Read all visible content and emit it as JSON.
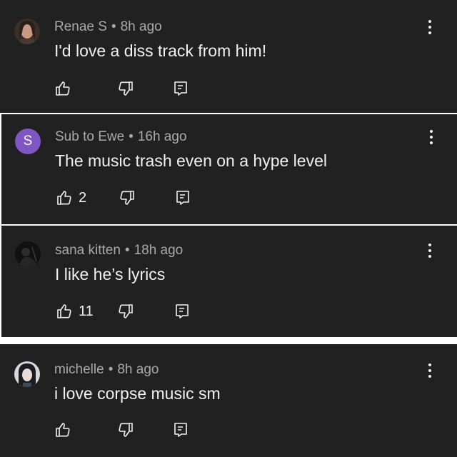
{
  "comments": [
    {
      "author": "Renae S",
      "time": "8h ago",
      "text": "I'd love a diss track from him!",
      "likes": "",
      "avatar_type": "photo-woman",
      "avatar_letter": ""
    },
    {
      "author": "Sub to Ewe",
      "time": "16h ago",
      "text": "The music trash even on a hype level",
      "likes": "2",
      "avatar_type": "letter",
      "avatar_letter": "S"
    },
    {
      "author": "sana kitten",
      "time": "18h ago",
      "text": "I like he’s lyrics",
      "likes": "11",
      "avatar_type": "photo-dark",
      "avatar_letter": ""
    },
    {
      "author": "michelle",
      "time": "8h ago",
      "text": "i love corpse music sm",
      "likes": "",
      "avatar_type": "photo-anime",
      "avatar_letter": ""
    }
  ],
  "separator": "•",
  "icons": {
    "like": "thumbs-up-icon",
    "dislike": "thumbs-down-icon",
    "reply": "reply-icon",
    "more": "more-vert-icon"
  },
  "colors": {
    "background": "#212121",
    "page": "#ffffff",
    "author": "#aaaaaa",
    "text": "#f1f1f1",
    "letter_avatar": "#7e57c2"
  }
}
